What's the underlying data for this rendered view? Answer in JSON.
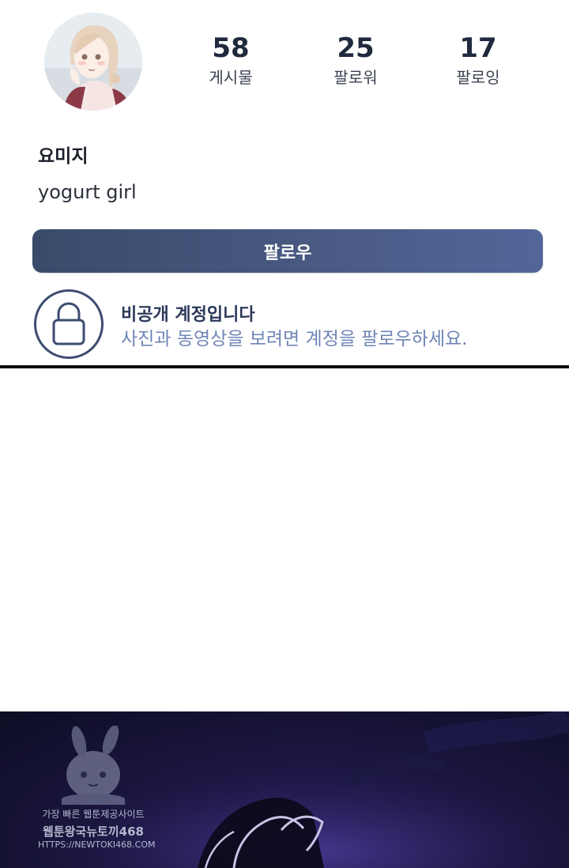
{
  "profile": {
    "username": "요미지",
    "bio": "yogurt girl",
    "stats": [
      {
        "value": "58",
        "label": "게시물"
      },
      {
        "value": "25",
        "label": "팔로워"
      },
      {
        "value": "17",
        "label": "팔로잉"
      }
    ],
    "follow_label": "팔로우"
  },
  "private_notice": {
    "title": "비공개 계정입니다",
    "description": "사진과 동영상을 보려면 계정을 팔로우하세요.",
    "icon": "lock-icon"
  },
  "watermark": {
    "line1": "가장 빠른 웹툰제공사이트",
    "line2": "웹툰왕국뉴토끼468",
    "line3": "HTTPS://NEWTOKI468.COM"
  },
  "colors": {
    "button_gradient_start": "#3a4a6a",
    "button_gradient_end": "#52669a",
    "notice_title": "#2d3a5a",
    "notice_desc": "#6f85b6",
    "comic_bg": "#1b1640"
  }
}
